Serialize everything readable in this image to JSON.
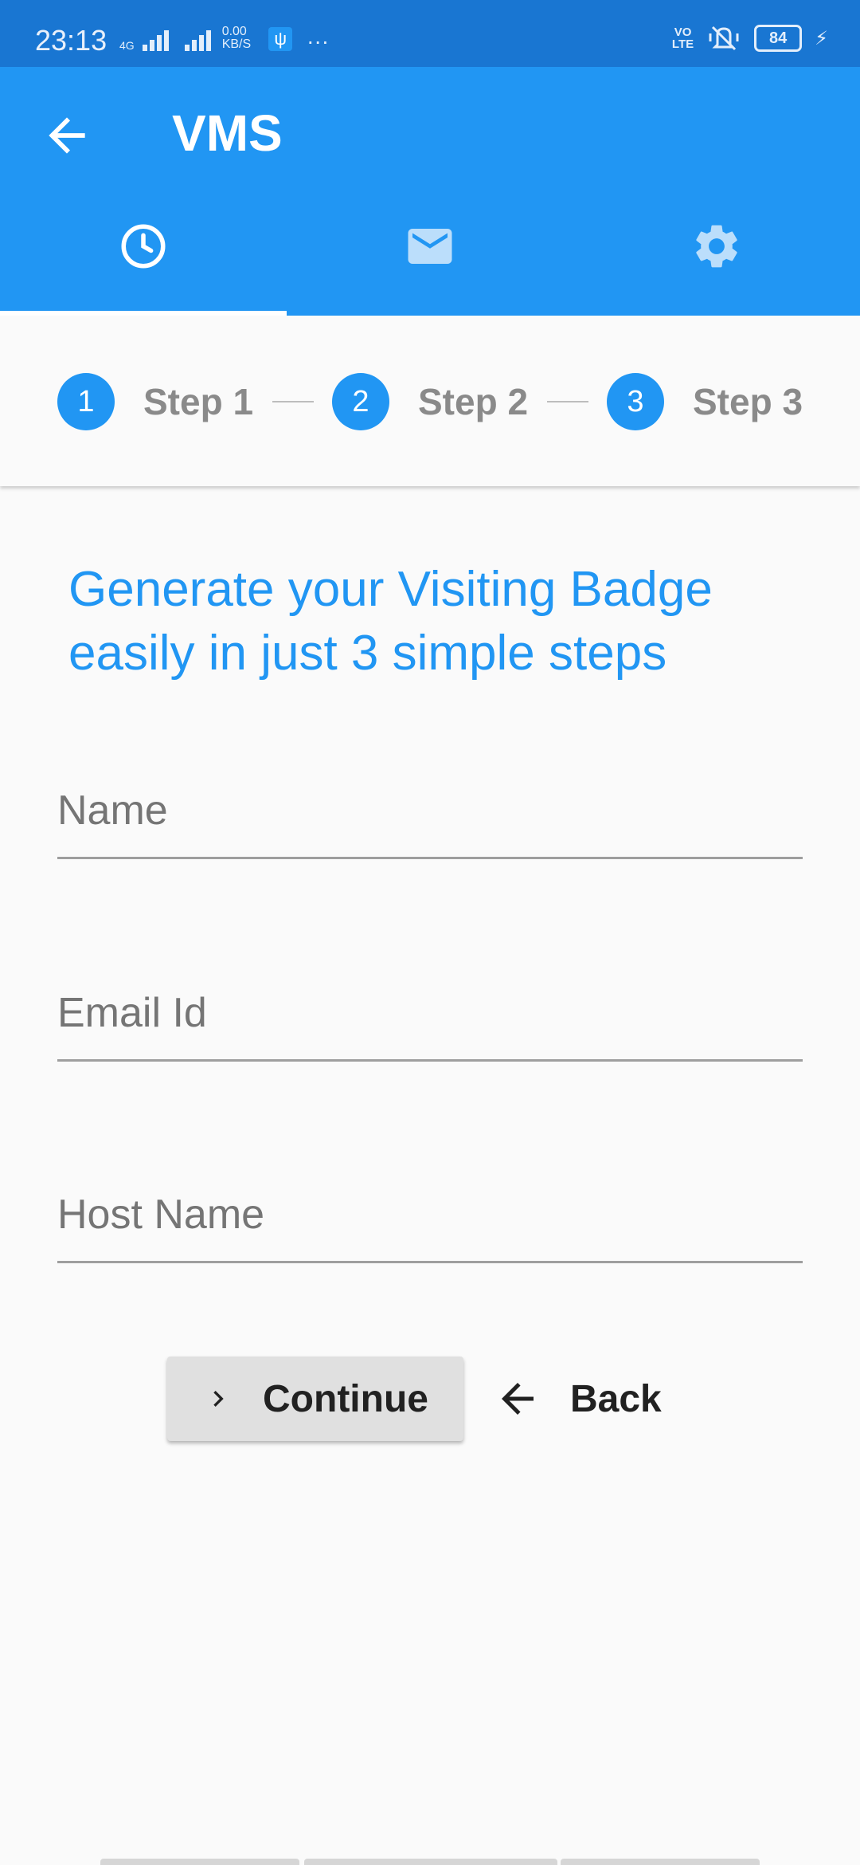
{
  "status_bar": {
    "time": "23:13",
    "network": "4G",
    "speed_value": "0.00",
    "speed_unit": "KB/S",
    "volte_top": "VO",
    "volte_bottom": "LTE",
    "battery": "84"
  },
  "app_bar": {
    "title": "VMS",
    "tabs": [
      {
        "icon": "clock-icon"
      },
      {
        "icon": "mail-icon"
      },
      {
        "icon": "gear-icon"
      }
    ],
    "active_tab": 0
  },
  "stepper": {
    "steps": [
      {
        "number": "1",
        "label": "Step 1"
      },
      {
        "number": "2",
        "label": "Step 2"
      },
      {
        "number": "3",
        "label": "Step 3"
      }
    ]
  },
  "form": {
    "headline": "Generate your Visiting Badge easily in just 3 simple steps",
    "fields": [
      {
        "placeholder": "Name",
        "value": ""
      },
      {
        "placeholder": "Email Id",
        "value": ""
      },
      {
        "placeholder": "Host Name",
        "value": ""
      }
    ],
    "continue_label": "Continue",
    "back_label": "Back"
  },
  "colors": {
    "status_bar": "#1976d2",
    "primary": "#2196f3",
    "background": "#fafafa",
    "button": "#e0e0e0"
  }
}
